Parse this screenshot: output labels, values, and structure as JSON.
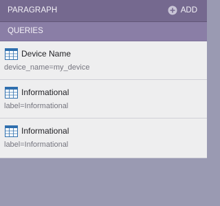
{
  "header": {
    "title": "PARAGRAPH",
    "add_label": "ADD",
    "add_icon": "plus-circle-icon"
  },
  "section": {
    "title": "QUERIES"
  },
  "queries": [
    {
      "name": "Device Name",
      "expression": "device_name=my_device",
      "icon": "table-icon"
    },
    {
      "name": "Informational",
      "expression": "label=Informational",
      "icon": "table-icon"
    },
    {
      "name": "Informational",
      "expression": "label=Informational",
      "icon": "table-icon"
    }
  ],
  "colors": {
    "header_bg": "#75698f",
    "section_bg": "#8a7ea6",
    "list_bg": "#eeeeef",
    "empty_bg": "#9a9ab2",
    "icon_blue": "#2f6fae"
  }
}
